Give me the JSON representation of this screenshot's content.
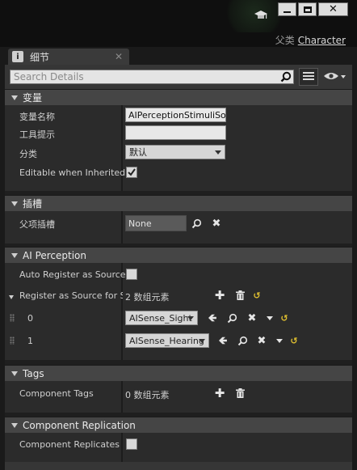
{
  "window": {
    "parent_label": "父类",
    "parent_value": "Character"
  },
  "tab": {
    "label": "细节"
  },
  "search": {
    "placeholder": "Search Details"
  },
  "sections": {
    "variable": {
      "title": "变量",
      "rows": {
        "var_name_label": "变量名称",
        "var_name_value": "AIPerceptionStimuliSou",
        "tooltip_label": "工具提示",
        "tooltip_value": "",
        "category_label": "分类",
        "category_value": "默认",
        "editable_label": "Editable when Inherited",
        "editable_checked": true
      }
    },
    "socket": {
      "title": "插槽",
      "parent_socket_label": "父项插槽",
      "parent_socket_value": "None"
    },
    "ai_perception": {
      "title": "AI Perception",
      "auto_register_label": "Auto Register as Source",
      "register_for_label": "Register as Source for Se",
      "register_for_count": "2 数组元素",
      "items": [
        {
          "index": "0",
          "value": "AISense_Sight"
        },
        {
          "index": "1",
          "value": "AISense_Hearing"
        }
      ]
    },
    "tags": {
      "title": "Tags",
      "component_tags_label": "Component Tags",
      "component_tags_count": "0 数组元素"
    },
    "replication": {
      "title": "Component Replication",
      "replicates_label": "Component Replicates"
    }
  }
}
